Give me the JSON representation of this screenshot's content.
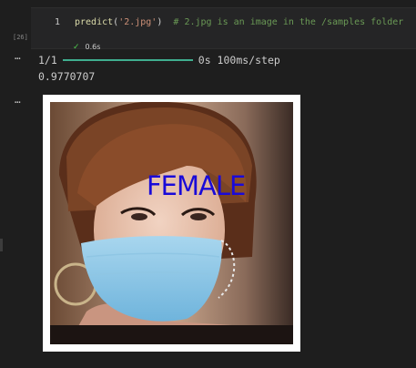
{
  "cell": {
    "execution_count": "[26]",
    "line_number": "1",
    "code": {
      "fn": "predict",
      "open": "(",
      "arg": "'2.jpg'",
      "close": ")",
      "comment": "# 2.jpg is an image in the /samples folder"
    },
    "status_time": "0.6s",
    "status_icon": "checkmark-icon"
  },
  "output": {
    "progress_step": "1/1",
    "progress_fraction": 1.0,
    "progress_time": "0s 100ms/step",
    "score": "0.9770707",
    "image_label": "FEMALE"
  },
  "colors": {
    "background": "#1e1e1e",
    "progress_bar": "#3fae8f",
    "label_text": "#1a0ad8",
    "check": "#4ec94e"
  }
}
